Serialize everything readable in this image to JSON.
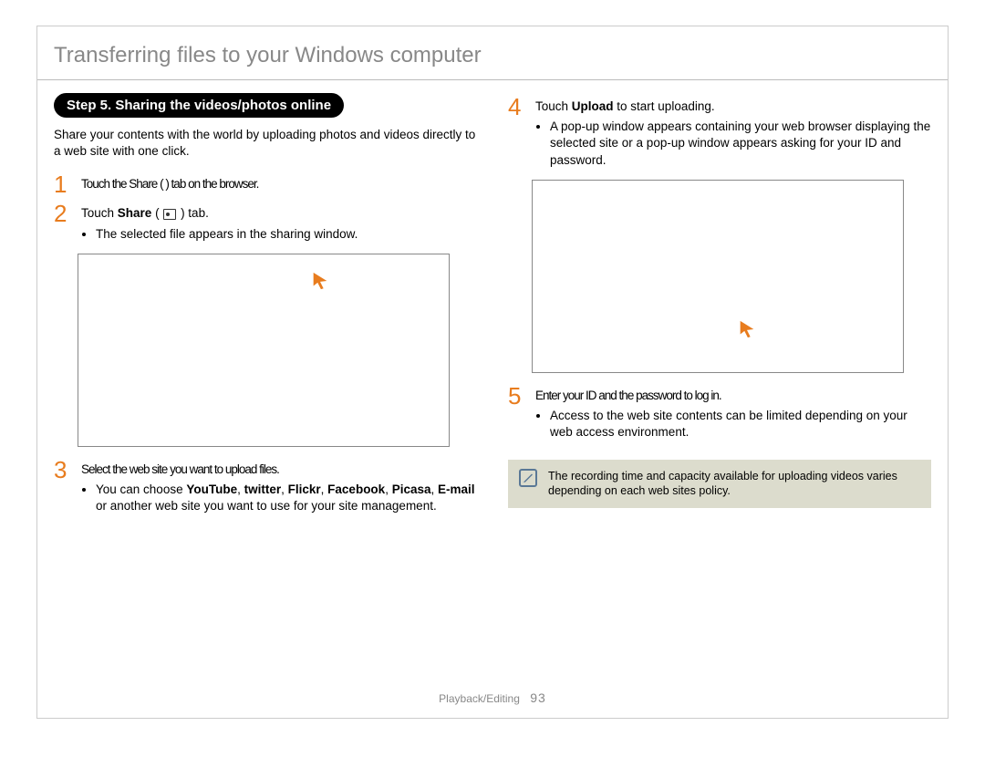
{
  "title": "Transferring files to your Windows computer",
  "step_badge": "Step 5. Sharing the videos/photos online",
  "intro": "Share your contents with the world by uploading photos and videos directly to a web site with one click.",
  "left": {
    "s1_rest": "Touch the Share (    ) tab on the browser.",
    "s2_label": "Share",
    "s2_bullet": "The selected file appears in the sharing window.",
    "s3_rest": "Select the web site you want to upload files.",
    "s3_b_pre": "You can choose ",
    "s3_b_bold1": "YouTube",
    "s3_b_mid1": ", ",
    "s3_b_bold2": "twitter",
    "s3_b_mid2": ", ",
    "s3_b_bold3": "Flickr",
    "s3_b_mid3": ", ",
    "s3_b_bold4": "Facebook",
    "s3_b_mid4": ", ",
    "s3_b_bold5": "Picasa",
    "s3_b_mid5": ", ",
    "s3_b_bold6": "E-mail",
    "s3_b_post": " or another web site you want to use for your site management."
  },
  "right": {
    "s4_label": "Upload",
    "s4_bullet": "A pop-up window appears containing your web browser displaying the selected site or a pop-up window appears asking for your ID and password.",
    "s5_rest": "Enter your ID and the password to log in.",
    "s5_bullet": "Access to the web site contents can be limited depending on your web access environment.",
    "note": "The recording time and capacity available for uploading videos varies depending on each web sites policy."
  },
  "footer_section": "Playback/Editing",
  "footer_page": "93"
}
